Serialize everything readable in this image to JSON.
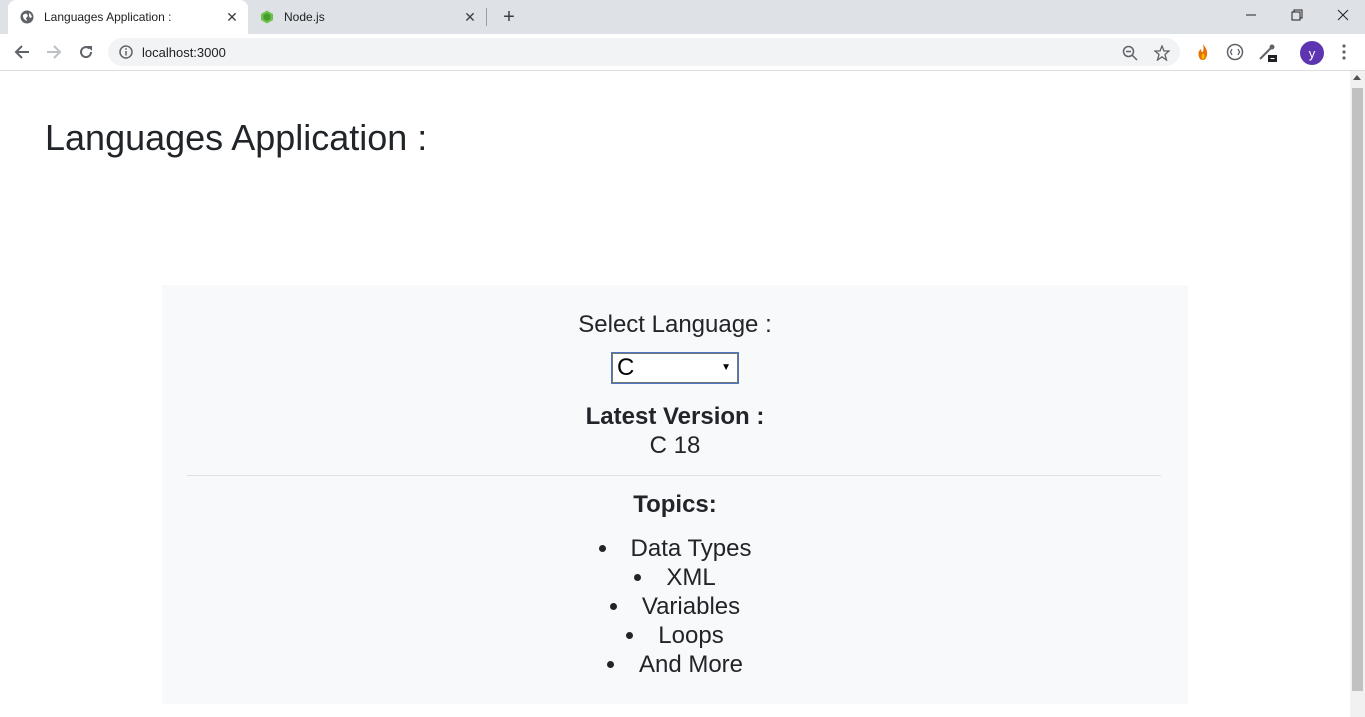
{
  "browser": {
    "tabs": [
      {
        "title": "Languages Application :",
        "active": true,
        "favicon": "globe-icon"
      },
      {
        "title": "Node.js",
        "active": false,
        "favicon": "nodejs-hexagon-icon"
      }
    ],
    "address": "localhost:3000",
    "profile_initial": "y"
  },
  "page": {
    "title": "Languages Application :",
    "select_label": "Select Language :",
    "selected_language": "C",
    "version_label": "Latest Version :",
    "version_value": "C 18",
    "topics_label": "Topics:",
    "topics": [
      "Data Types",
      "XML",
      "Variables",
      "Loops",
      "And More"
    ]
  },
  "colors": {
    "avatar": "#5e35b1",
    "card_background": "#f8f9fa",
    "text": "#212529"
  }
}
